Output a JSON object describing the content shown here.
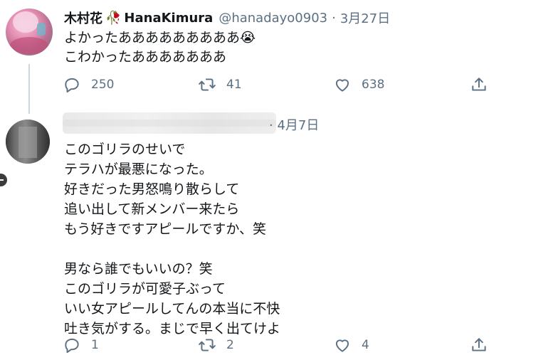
{
  "tweet1": {
    "display_name": "木村花",
    "display_name_suffix": "HanaKimura",
    "handle": "@hanadayo0903",
    "separator": "·",
    "date": "3月27日",
    "lines": [
      "よかったあああああああああ😭",
      "こわかったあああああああ"
    ],
    "reply_count": "250",
    "retweet_count": "41",
    "like_count": "638"
  },
  "tweet2": {
    "separator": "·",
    "date": "4月7日",
    "lines": [
      "このゴリラのせいで",
      "テラハが最悪になった。",
      "好きだった男怒鳴り散らして",
      "追い出して新メンバー来たら",
      "もう好きですアピールですか、笑",
      "",
      "男なら誰でもいいの？笑",
      "このゴリラが可愛子ぶって",
      "いい女アピールしてんの本当に不快",
      "吐き気がする。まじで早く出てけよ"
    ],
    "reply_count": "1",
    "retweet_count": "2",
    "like_count": "4"
  },
  "icons": {
    "reply": "reply-icon",
    "retweet": "retweet-icon",
    "like": "heart-icon",
    "share": "share-icon",
    "name_emoji": "rose-icon"
  },
  "colors": {
    "text": "#14171a",
    "secondary": "#5b7083",
    "thread_line": "#ccd6dd"
  }
}
